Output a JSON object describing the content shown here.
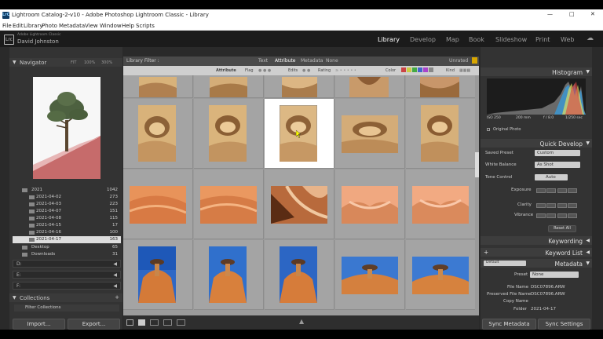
{
  "window": {
    "title": "Lightroom Catalog-2-v10 - Adobe Photoshop Lightroom Classic - Library",
    "app_icon": "LrC"
  },
  "menu": [
    "File",
    "Edit",
    "Library",
    "Photo",
    "Metadata",
    "View",
    "Window",
    "Help",
    "Scripts"
  ],
  "identity": {
    "catalog": "Adobe Lightroom Classic",
    "user": "David Johnston",
    "logo": "Lrc"
  },
  "modules": [
    "Library",
    "Develop",
    "Map",
    "Book",
    "Slideshow",
    "Print",
    "Web"
  ],
  "active_module": "Library",
  "navigator": {
    "title": "Navigator",
    "zooms": [
      "FIT",
      "100%",
      "300%"
    ]
  },
  "folders": [
    {
      "name": "2021",
      "count": "1042"
    },
    {
      "name": "2021-04-02",
      "count": "273"
    },
    {
      "name": "2021-04-03",
      "count": "223"
    },
    {
      "name": "2021-04-07",
      "count": "151"
    },
    {
      "name": "2021-04-08",
      "count": "115"
    },
    {
      "name": "2021-04-15",
      "count": "17"
    },
    {
      "name": "2021-04-16",
      "count": "100"
    },
    {
      "name": "2021-04-17",
      "count": "163"
    },
    {
      "name": "Desktop",
      "count": "65"
    },
    {
      "name": "Downloads",
      "count": "31"
    }
  ],
  "volumes": [
    "D:",
    "E:",
    "F:"
  ],
  "collections": {
    "title": "Collections",
    "item": "Filter Collections"
  },
  "buttons": {
    "import": "Import...",
    "export": "Export...",
    "sync_metadata": "Sync Metadata",
    "sync_settings": "Sync Settings"
  },
  "library_filter": {
    "label": "Library Filter :",
    "tabs": [
      "Text",
      "Attribute",
      "Metadata",
      "None"
    ],
    "active_tab": "Attribute",
    "preset": "Unrated"
  },
  "attribute_bar": {
    "label": "Attribute",
    "flag": "Flag",
    "edits": "Edits",
    "rating": "Rating",
    "color": "Color",
    "kind": "Kind"
  },
  "histogram": {
    "title": "Histogram",
    "iso": "ISO 250",
    "focal": "200 mm",
    "aperture": "f / 8.0",
    "shutter": "1/250 sec",
    "original": "Original Photo"
  },
  "quick_develop": {
    "title": "Quick Develop",
    "saved_preset_label": "Saved Preset",
    "saved_preset_value": "Custom",
    "white_balance_label": "White Balance",
    "white_balance_value": "As Shot",
    "tone_control_label": "Tone Control",
    "auto_label": "Auto",
    "exposure_label": "Exposure",
    "clarity_label": "Clarity",
    "vibrance_label": "Vibrance",
    "reset_all": "Reset All"
  },
  "keywording": {
    "title": "Keywording"
  },
  "keyword_list": {
    "title": "Keyword List"
  },
  "metadata": {
    "title": "Metadata",
    "view": "Default",
    "preset_label": "Preset",
    "preset_value": "None",
    "file_name_label": "File Name",
    "file_name": "DSC07896.ARW",
    "preserved_label": "Preserved File Name",
    "preserved": "DSC07896.ARW",
    "copy_name_label": "Copy Name",
    "folder_label": "Folder",
    "folder": "2021-04-17"
  }
}
